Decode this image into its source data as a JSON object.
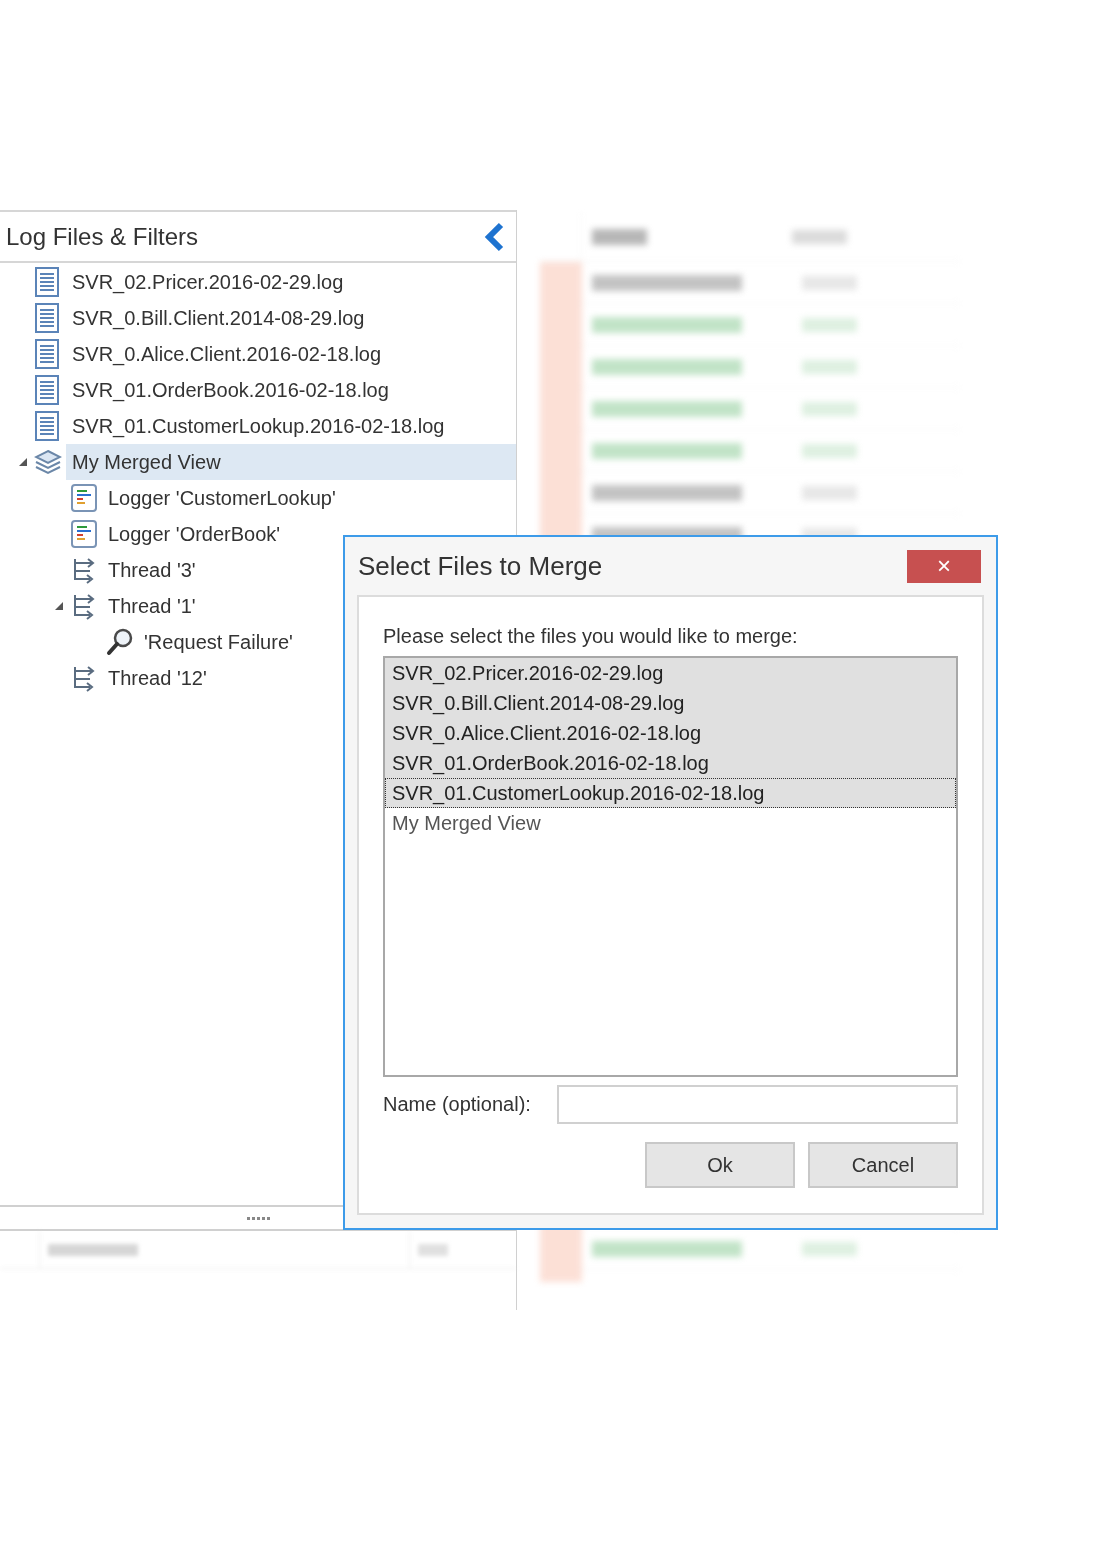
{
  "panel": {
    "title": "Log Files & Filters",
    "tree": [
      {
        "kind": "file",
        "label": "SVR_02.Pricer.2016-02-29.log",
        "selected": false
      },
      {
        "kind": "file",
        "label": "SVR_0.Bill.Client.2014-08-29.log",
        "selected": false
      },
      {
        "kind": "file",
        "label": "SVR_0.Alice.Client.2016-02-18.log",
        "selected": false
      },
      {
        "kind": "file",
        "label": "SVR_01.OrderBook.2016-02-18.log",
        "selected": false
      },
      {
        "kind": "file",
        "label": "SVR_01.CustomerLookup.2016-02-18.log",
        "selected": false
      },
      {
        "kind": "merged",
        "label": "My Merged View",
        "selected": true,
        "expanded": true,
        "children": [
          {
            "kind": "logger",
            "label": "Logger 'CustomerLookup'",
            "selected": false
          },
          {
            "kind": "logger",
            "label": "Logger 'OrderBook'",
            "selected": false
          },
          {
            "kind": "thread",
            "label": "Thread '3'",
            "selected": false
          },
          {
            "kind": "thread",
            "label": "Thread '1'",
            "selected": false,
            "expanded": true,
            "children": [
              {
                "kind": "filter",
                "label": "'Request Failure'",
                "selected": false
              }
            ]
          },
          {
            "kind": "thread",
            "label": "Thread '12'",
            "selected": false
          }
        ]
      }
    ]
  },
  "dialog": {
    "title": "Select Files to Merge",
    "close": "×",
    "prompt": "Please select the files you would like to merge:",
    "items": [
      {
        "label": "SVR_02.Pricer.2016-02-29.log",
        "selected": true,
        "focused": false
      },
      {
        "label": "SVR_0.Bill.Client.2014-08-29.log",
        "selected": true,
        "focused": false
      },
      {
        "label": "SVR_0.Alice.Client.2016-02-18.log",
        "selected": true,
        "focused": false
      },
      {
        "label": "SVR_01.OrderBook.2016-02-18.log",
        "selected": true,
        "focused": false
      },
      {
        "label": "SVR_01.CustomerLookup.2016-02-18.log",
        "selected": true,
        "focused": true
      },
      {
        "label": "My Merged View",
        "selected": false,
        "focused": false
      }
    ],
    "name_label": "Name (optional):",
    "buttons": [
      "Ok",
      "Cancel"
    ]
  }
}
